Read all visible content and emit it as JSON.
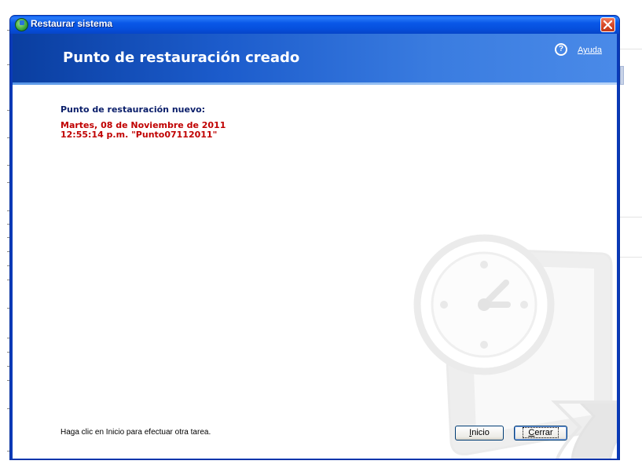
{
  "window": {
    "title": "Restaurar sistema",
    "header_title": "Punto de restauración creado",
    "help_icon_glyph": "?",
    "help_link": "Ayuda"
  },
  "content": {
    "label": "Punto de restauración nuevo:",
    "date_line": "Martes, 08 de Noviembre de 2011",
    "time_line": "12:55:14 p.m.  \"Punto07112011\""
  },
  "footer": {
    "instruction": "Haga clic en Inicio para efectuar otra tarea.",
    "inicio_accel": "I",
    "inicio_rest": "nicio",
    "cerrar_accel": "C",
    "cerrar_rest": "errar"
  },
  "icons": [
    "system-restore-icon",
    "close-icon",
    "help-icon",
    "restore-clock-watermark"
  ],
  "colors": {
    "title_bar": "#0a58e8",
    "header": "#1c5ccc",
    "label": "#0a1e6a",
    "restore_point": "#c00000",
    "close_button": "#d84a2a"
  }
}
